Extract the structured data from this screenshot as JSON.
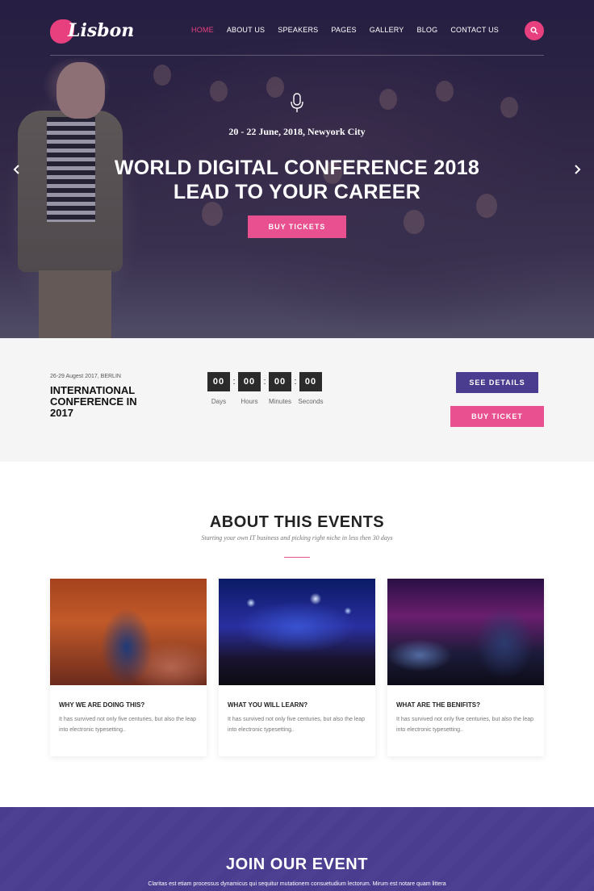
{
  "brand": {
    "name": "Lisbon",
    "accent": "#e8407f",
    "primary": "#4a3d8f"
  },
  "nav": {
    "items": [
      {
        "label": "HOME",
        "active": true
      },
      {
        "label": "ABOUT US",
        "active": false
      },
      {
        "label": "SPEAKERS",
        "active": false
      },
      {
        "label": "PAGES",
        "active": false
      },
      {
        "label": "GALLERY",
        "active": false
      },
      {
        "label": "BLOG",
        "active": false
      },
      {
        "label": "CONTACT US",
        "active": false
      }
    ],
    "search_icon": "search-icon"
  },
  "hero": {
    "icon": "microphone-icon",
    "date": "20 - 22 June, 2018, Newyork City",
    "title_line1": "WORLD DIGITAL CONFERENCE 2018",
    "title_line2": "LEAD TO YOUR CAREER",
    "cta": "BUY TICKETS",
    "prev_icon": "chevron-left-icon",
    "next_icon": "chevron-right-icon"
  },
  "event_bar": {
    "meta": "26-29 Augest 2017, BERLIN",
    "name": "INTERNATIONAL CONFERENCE IN 2017",
    "countdown": [
      {
        "value": "00",
        "label": "Days"
      },
      {
        "value": "00",
        "label": "Hours"
      },
      {
        "value": "00",
        "label": "Minutes"
      },
      {
        "value": "00",
        "label": "Seconds"
      }
    ],
    "see_details": "SEE DETAILS",
    "buy_ticket": "BUY TICKET"
  },
  "about": {
    "title": "ABOUT THIS EVENTS",
    "subtitle": "Starting your own IT business and picking right niche in less then 30 days",
    "cards": [
      {
        "title": "WHY WE ARE DOING THIS?",
        "text": "It has survived not only five centuries, but also the leap into electronic typesetting.."
      },
      {
        "title": "WHAT YOU WILL LEARN?",
        "text": "It has survived not only five centuries, but also the leap into electronic typesetting.."
      },
      {
        "title": "WHAT ARE THE BENIFITS?",
        "text": "It has survived not only five centuries, but also the leap into electronic typesetting.."
      }
    ]
  },
  "join": {
    "title": "JOIN OUR EVENT",
    "text": "Claritas est etiam processus dynamicus qui sequitur mutationem consuetudium lectorum. Mirum est notare quam littera"
  }
}
